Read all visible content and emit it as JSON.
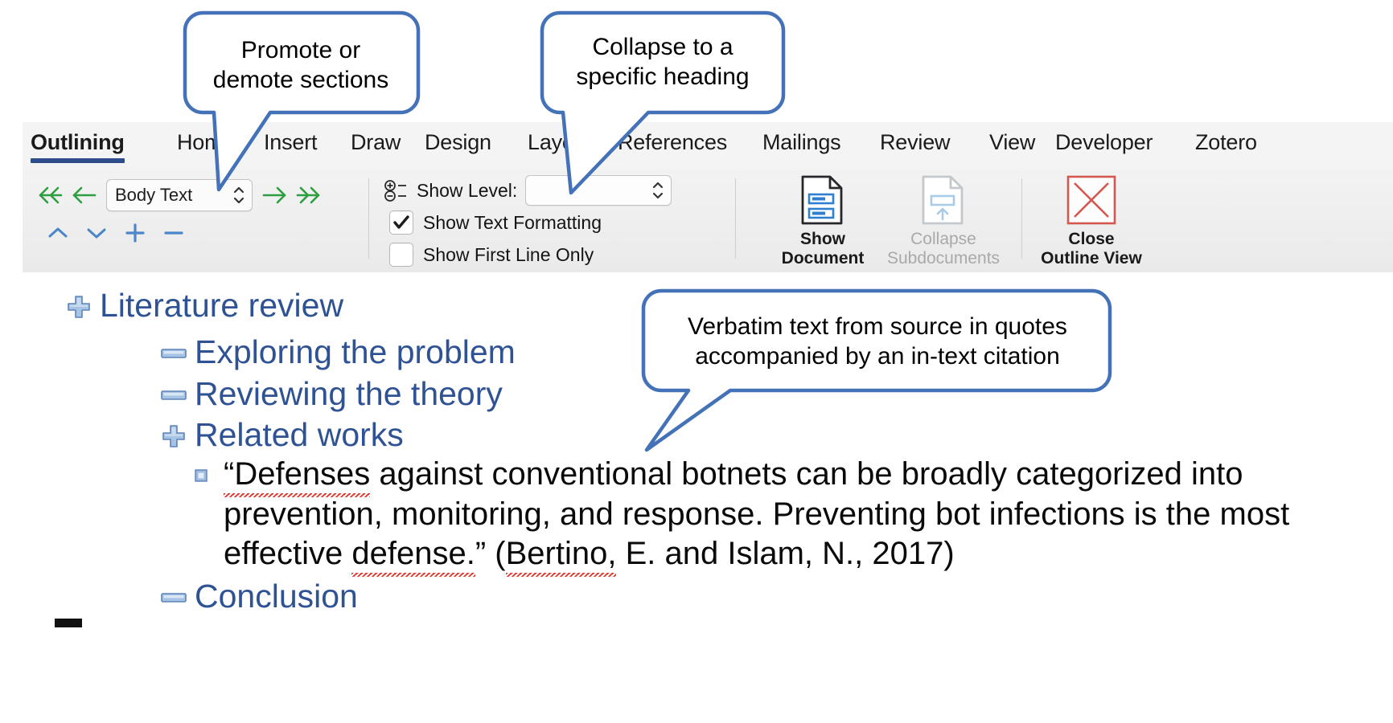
{
  "app": {
    "view": "Word Outline View"
  },
  "ribbon": {
    "tabs": [
      {
        "label": "Outlining",
        "active": true
      },
      {
        "label": "Home",
        "active": false
      },
      {
        "label": "Insert",
        "active": false
      },
      {
        "label": "Draw",
        "active": false
      },
      {
        "label": "Design",
        "active": false
      },
      {
        "label": "Layout",
        "active": false
      },
      {
        "label": "References",
        "active": false
      },
      {
        "label": "Mailings",
        "active": false
      },
      {
        "label": "Review",
        "active": false
      },
      {
        "label": "View",
        "active": false
      },
      {
        "label": "Developer",
        "active": false
      },
      {
        "label": "Zotero",
        "active": false
      }
    ],
    "outline_tools": {
      "promote_to_heading1_icon": "double-left-arrow-icon",
      "promote_icon": "left-arrow-icon",
      "level_value": "Body Text",
      "demote_icon": "right-arrow-icon",
      "demote_to_body_icon": "double-right-arrow-icon",
      "move_up_icon": "chevron-up-icon",
      "move_down_icon": "chevron-down-icon",
      "expand_icon": "plus-icon",
      "collapse_icon": "minus-icon"
    },
    "outline_options": {
      "show_level_icon": "show-level-icon",
      "show_level_label": "Show Level:",
      "show_level_value": "",
      "show_text_formatting_label": "Show Text Formatting",
      "show_text_formatting_checked": true,
      "show_first_line_only_label": "Show First Line Only",
      "show_first_line_only_checked": false
    },
    "master_document": {
      "show_document_label": "Show\nDocument",
      "show_document_icon": "document-expand-icon",
      "collapse_subdocuments_label": "Collapse\nSubdocuments",
      "collapse_subdocuments_icon": "document-collapse-icon",
      "collapse_subdocuments_disabled": true
    },
    "close": {
      "label": "Close\nOutline View",
      "icon": "close-x-icon"
    }
  },
  "outline": {
    "items": [
      {
        "marker": "plus-marker",
        "text": "Literature review",
        "indent": 0
      },
      {
        "marker": "dash-marker",
        "text": "Exploring the problem",
        "indent": 1
      },
      {
        "marker": "dash-marker",
        "text": "Reviewing the theory",
        "indent": 1
      },
      {
        "marker": "plus-marker",
        "text": "Related works",
        "indent": 1
      },
      {
        "marker": "dot-marker",
        "text": "",
        "indent": 2
      },
      {
        "marker": "dash-marker",
        "text": "Conclusion",
        "indent": 1
      }
    ],
    "body_paragraph": {
      "marker": "small-square-marker",
      "text": "“Defenses against conventional botnets can be broadly categorized into prevention, monitoring, and response. Preventing bot infections is the most effective defense.” (Bertino, E. and Islam, N., 2017)",
      "misspelled_words": [
        "Defenses",
        "defense.",
        "Bertino,"
      ]
    }
  },
  "callouts": [
    {
      "id": "promote-demote",
      "text": "Promote or\ndemote sections",
      "font_size": 30
    },
    {
      "id": "collapse-heading",
      "text": "Collapse to a\nspecific heading",
      "font_size": 30
    },
    {
      "id": "verbatim-quote",
      "text": "Verbatim text from source in quotes\naccompanied by an in-text citation",
      "font_size": 30
    }
  ],
  "colors": {
    "callout_stroke": "#4472b8",
    "outline_text": "#2e5293",
    "active_tab_underline": "#2f4d8a",
    "arrow_green": "#2f9e41",
    "arrow_blue": "#4a86c8",
    "close_red": "#d4584f",
    "spell_error": "#e0342a"
  }
}
